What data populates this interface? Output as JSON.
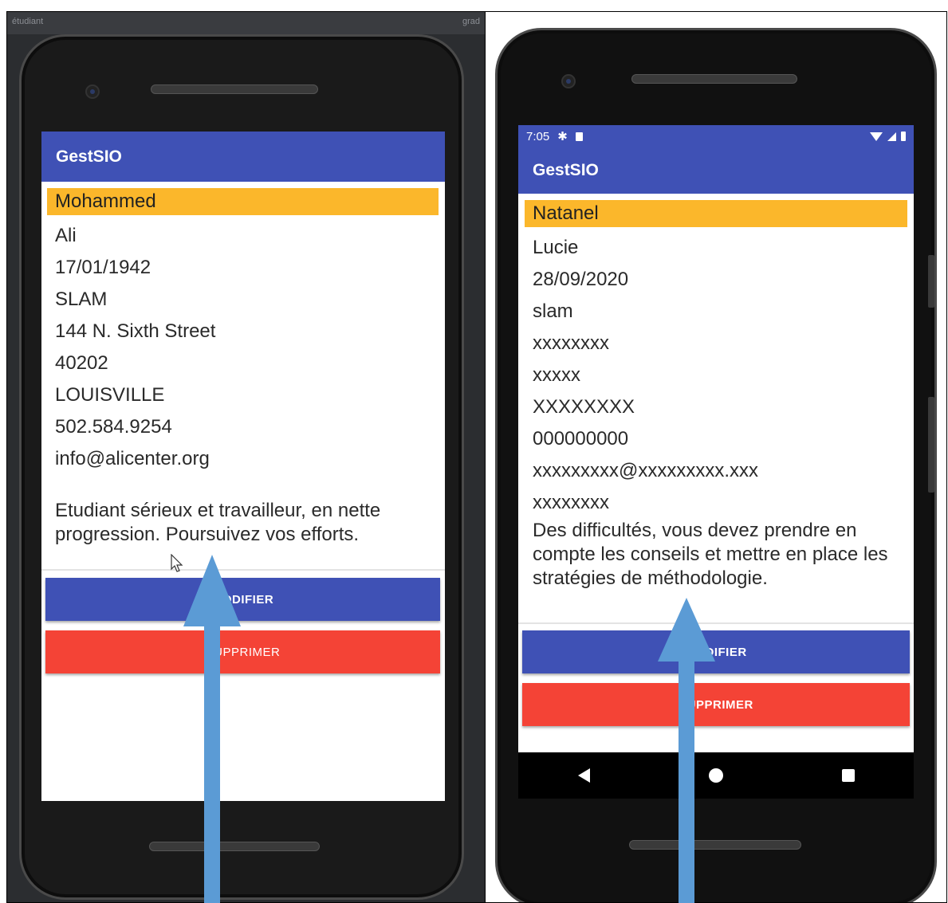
{
  "app_title": "GestSIO",
  "left": {
    "desktop_hint_left": "étudiant",
    "desktop_hint_right": "grad",
    "record": {
      "nom": "Mohammed",
      "prenom": "Ali",
      "date_naissance": "17/01/1942",
      "option": "SLAM",
      "adresse": "144 N. Sixth Street",
      "code_postal": "40202",
      "ville": "LOUISVILLE",
      "telephone": "502.584.9254",
      "email": "info@alicenter.org",
      "commentaire": "Etudiant sérieux et travailleur, en nette progression. Poursuivez vos efforts."
    },
    "buttons": {
      "modifier": "MODIFIER",
      "supprimer": "SUPPRIMER"
    }
  },
  "right": {
    "status_bar": {
      "time": "7:05",
      "icons_left": [
        "gear-icon",
        "sd-card-icon"
      ],
      "icons_right": [
        "wifi-icon",
        "signal-icon",
        "battery-icon"
      ]
    },
    "record": {
      "nom": "Natanel",
      "prenom": "Lucie",
      "date_naissance": "28/09/2020",
      "option": "slam",
      "adresse": "xxxxxxxx",
      "code_postal": "xxxxx",
      "ville": "XXXXXXXX",
      "telephone": "000000000",
      "email": "xxxxxxxxx@xxxxxxxxx.xxx",
      "extra": "xxxxxxxx",
      "commentaire": "Des difficultés, vous devez prendre en compte les conseils et mettre en place les stratégies de méthodologie."
    },
    "buttons": {
      "modifier": "MODIFIER",
      "supprimer": "SUPPRIMER"
    },
    "nav_bar": [
      "back-icon",
      "home-icon",
      "recents-icon"
    ]
  },
  "colors": {
    "primary": "#3f51b5",
    "name_highlight": "#fbb72b",
    "delete": "#f44336",
    "annotation_arrow": "#5b9bd5"
  }
}
